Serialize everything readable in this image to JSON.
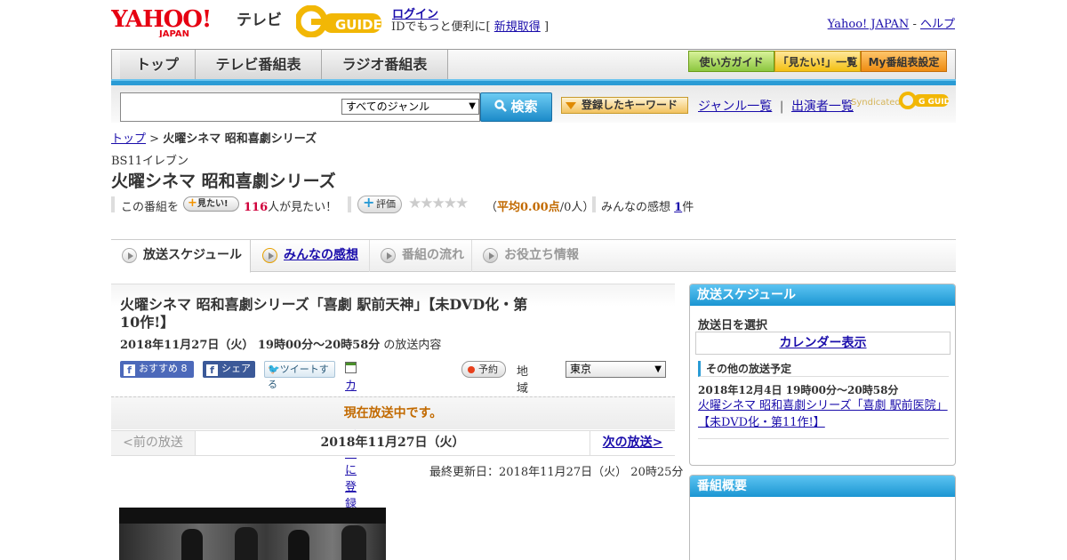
{
  "header": {
    "tv_label": "テレビ",
    "login": "ログイン",
    "login_sub_prefix": "IDでもっと便利に[",
    "signup": "新規取得",
    "login_sub_suffix": "]",
    "yahoo_japan": "Yahoo! JAPAN",
    "help": "ヘルプ",
    "toplinks_sep": "-"
  },
  "nav": {
    "tabs": [
      "トップ",
      "テレビ番組表",
      "ラジオ番組表"
    ],
    "guide_buttons": [
      "使い方ガイド",
      "「見たい!」一覧",
      "My番組表設定"
    ]
  },
  "search": {
    "genre_selected": "すべてのジャンル",
    "button": "検索",
    "keyword_button": "登録したキーワード",
    "genre_list": "ジャンル一覧",
    "performers": "出演者一覧",
    "syndicated": "Syndicated",
    "syndicated_logo": "G GUIDE"
  },
  "breadcrumb": {
    "top": "トップ",
    "sep": ">",
    "current": "火曜シネマ 昭和喜劇シリーズ"
  },
  "program": {
    "station": "BS11イレブン",
    "title": "火曜シネマ 昭和喜劇シリーズ",
    "want_prefix": "この番組を",
    "want_button": "見たい!",
    "want_count": "116",
    "want_suffix": "人が見たい！",
    "rating_button": "評価",
    "rating_open": "（",
    "rating_avg": "平均0.00点",
    "rating_people": "/0人）",
    "impressions_label": "みんなの感想",
    "impressions_count": "1",
    "impressions_suffix": "件",
    "stars": 0
  },
  "tabs": [
    "放送スケジュール",
    "みんなの感想",
    "番組の流れ",
    "お役立ち情報"
  ],
  "episode": {
    "title": "火曜シネマ 昭和喜劇シリーズ「喜劇 駅前天神」【未DVD化・第10作!】",
    "air_date": "2018年11月27日（火） 19時00分～20時58分",
    "air_suffix": "の放送内容",
    "fb_recommend": "おすすめ",
    "fb_count": "8",
    "fb_share": "シェア",
    "tweet": "ツイートする",
    "calendar": "カレンダーに登録",
    "reserve": "予約",
    "region_label": "地域設定",
    "region": "東京",
    "onair": "現在放送中です。",
    "prev": "<前の放送",
    "current_date": "2018年11月27日（火）",
    "next": "次の放送>",
    "updated": "最終更新日：2018年11月27日（火） 20時25分"
  },
  "sidebar": {
    "schedule_title": "放送スケジュール",
    "select_date": "放送日を選択",
    "calendar_link": "カレンダー表示",
    "other_title": "その他の放送予定",
    "other_date": "2018年12月4日 19時00分～20時58分",
    "other_link": "火曜シネマ 昭和喜劇シリーズ「喜劇 駅前医院」【未DVD化・第11作!】",
    "overview_title": "番組概要"
  },
  "colors": {
    "accent_blue": "#2a9bd5",
    "onair_orange": "#c26a00",
    "want_red": "#d0003b",
    "link": "#1a0dab"
  }
}
